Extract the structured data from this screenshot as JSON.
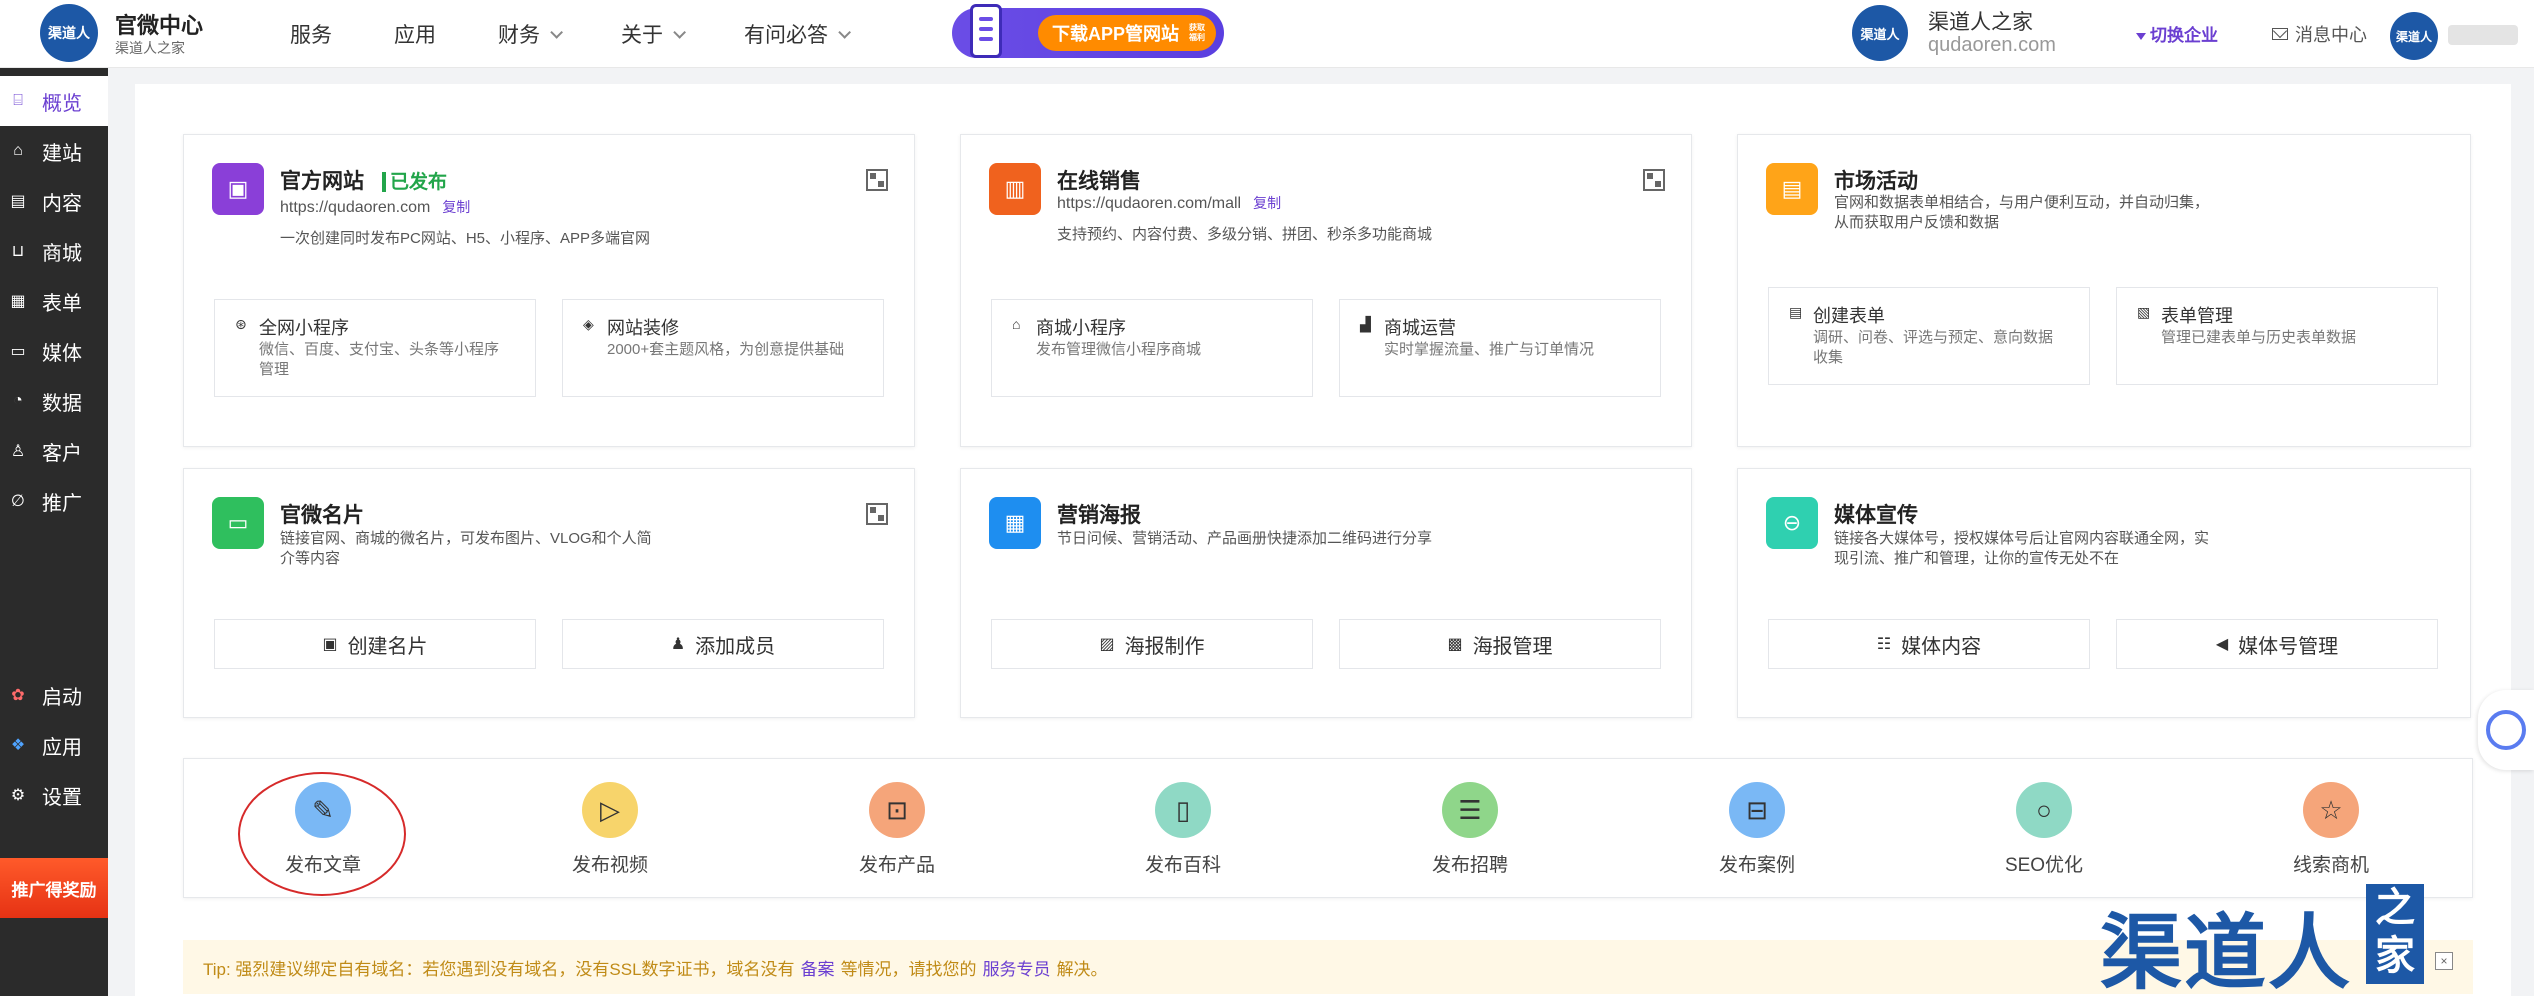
{
  "header": {
    "logo_text": "渠道人",
    "brand_title": "官微中心",
    "brand_sub": "渠道人之家",
    "nav": [
      {
        "label": "服务",
        "dropdown": false
      },
      {
        "label": "应用",
        "dropdown": false
      },
      {
        "label": "财务",
        "dropdown": true
      },
      {
        "label": "关于",
        "dropdown": true
      },
      {
        "label": "有问必答",
        "dropdown": true
      }
    ],
    "app_banner": {
      "label": "下载APP管网站",
      "badge": "获取 福利"
    },
    "org": {
      "logo_text": "渠道人",
      "name": "渠道人之家",
      "domain": "qudaoren.com"
    },
    "switch_label": "切换企业",
    "message_label": "消息中心",
    "user_logo_text": "渠道人"
  },
  "sidebar": {
    "items": [
      {
        "label": "概览",
        "icon": "overview-icon",
        "active": true
      },
      {
        "label": "建站",
        "icon": "home-icon"
      },
      {
        "label": "内容",
        "icon": "document-icon"
      },
      {
        "label": "商城",
        "icon": "cart-icon"
      },
      {
        "label": "表单",
        "icon": "form-icon"
      },
      {
        "label": "媒体",
        "icon": "video-icon"
      },
      {
        "label": "数据",
        "icon": "chart-icon"
      },
      {
        "label": "客户",
        "icon": "user-icon"
      },
      {
        "label": "推广",
        "icon": "link-icon"
      }
    ],
    "bottom_items": [
      {
        "label": "启动",
        "icon": "launch-icon"
      },
      {
        "label": "应用",
        "icon": "apps-icon"
      },
      {
        "label": "设置",
        "icon": "gear-icon"
      }
    ],
    "promo": "推广得奖励"
  },
  "cards": {
    "website": {
      "title": "官方网站",
      "status": "已发布",
      "url": "https://qudaoren.com",
      "copy": "复制",
      "desc": "一次创建同时发布PC网站、H5、小程序、APP多端官网",
      "subs": [
        {
          "title": "全网小程序",
          "desc": "微信、百度、支付宝、头条等小程序管理"
        },
        {
          "title": "网站装修",
          "desc": "2000+套主题风格，为创意提供基础"
        }
      ]
    },
    "sales": {
      "title": "在线销售",
      "url": "https://qudaoren.com/mall",
      "copy": "复制",
      "desc": "支持预约、内容付费、多级分销、拼团、秒杀多功能商城",
      "subs": [
        {
          "title": "商城小程序",
          "desc": "发布管理微信小程序商城"
        },
        {
          "title": "商城运营",
          "desc": "实时掌握流量、推广与订单情况"
        }
      ]
    },
    "market": {
      "title": "市场活动",
      "desc1": "官网和数据表单相结合，与用户便利互动，并自动归集，",
      "desc2": "从而获取用户反馈和数据",
      "subs": [
        {
          "title": "创建表单",
          "desc": "调研、问卷、评选与预定、意向数据收集"
        },
        {
          "title": "表单管理",
          "desc": "管理已建表单与历史表单数据"
        }
      ]
    },
    "card": {
      "title": "官微名片",
      "desc1": "链接官网、商城的微名片，可发布图片、VLOG和个人简",
      "desc2": "介等内容",
      "buttons": [
        "创建名片",
        "添加成员"
      ]
    },
    "poster": {
      "title": "营销海报",
      "desc1": "节日问候、营销活动、产品画册快捷添加二维码进行分享",
      "buttons": [
        "海报制作",
        "海报管理"
      ]
    },
    "media": {
      "title": "媒体宣传",
      "desc1": "链接各大媒体号，授权媒体号后让官网内容联通全网，实",
      "desc2": "现引流、推广和管理，让你的宣传无处不在",
      "buttons": [
        "媒体内容",
        "媒体号管理"
      ]
    }
  },
  "quick_actions": [
    {
      "label": "发布文章",
      "icon": "edit-icon",
      "color": "#7ab8f5"
    },
    {
      "label": "发布视频",
      "icon": "play-icon",
      "color": "#f7d46b"
    },
    {
      "label": "发布产品",
      "icon": "box-icon",
      "color": "#f5a57a"
    },
    {
      "label": "发布百科",
      "icon": "book-icon",
      "color": "#8fd9c5"
    },
    {
      "label": "发布招聘",
      "icon": "doc-icon",
      "color": "#8fd68a"
    },
    {
      "label": "发布案例",
      "icon": "inbox-icon",
      "color": "#7ab8f5"
    },
    {
      "label": "SEO优化",
      "icon": "search-icon",
      "color": "#8fd9c5"
    },
    {
      "label": "线索商机",
      "icon": "star-icon",
      "color": "#f5a57a"
    }
  ],
  "tip": {
    "prefix": "Tip: 强烈建议绑定自有域名：若您遇到没有域名，没有SSL数字证书，域名没有",
    "link1": "备案",
    "mid": "等情况，请找您的",
    "link2": "服务专员",
    "suffix": "解决。"
  },
  "watermark": {
    "text": "渠道人",
    "box": "之家"
  },
  "colors": {
    "accent": "#6b3fd1",
    "brand_blue": "#1d58a6",
    "success": "#22a54a",
    "sidebar_bg": "#2b2b2b"
  }
}
